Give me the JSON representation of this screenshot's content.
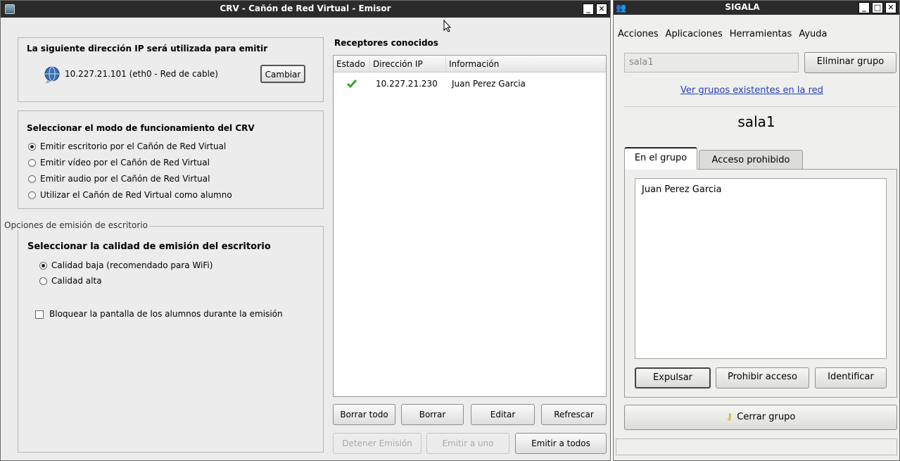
{
  "crv": {
    "title": "CRV - Cañón de Red Virtual - Emisor",
    "ip_section": {
      "heading": "La siguiente dirección IP será utilizada para emitir",
      "ip_text": "10.227.21.101 (eth0 - Red de cable)",
      "change_button": "Cambiar"
    },
    "mode_section": {
      "heading": "Seleccionar el modo de funcionamiento del CRV",
      "options": [
        {
          "label": "Emitir escritorio por el Cañón de Red Virtual",
          "selected": true
        },
        {
          "label": "Emitir vídeo por el Cañón de Red Virtual",
          "selected": false
        },
        {
          "label": "Emitir audio por el Cañón de Red Virtual",
          "selected": false
        },
        {
          "label": "Utilizar el Cañón de Red Virtual como alumno",
          "selected": false
        }
      ]
    },
    "desktop_options": {
      "legend": "Opciones de emisión de escritorio",
      "quality_heading": "Seleccionar la calidad de emisión del escritorio",
      "quality_options": [
        {
          "label": "Calidad baja (recomendado para WiFi)",
          "selected": true
        },
        {
          "label": "Calidad alta",
          "selected": false
        }
      ],
      "lock_label": "Bloquear la pantalla de los alumnos durante la emisión",
      "lock_checked": false
    },
    "receivers": {
      "heading": "Receptores conocidos",
      "columns": [
        "Estado",
        "Dirección IP",
        "Información"
      ],
      "rows": [
        {
          "status_icon": "check-icon",
          "ip": "10.227.21.230",
          "info": "Juan Perez Garcia"
        }
      ]
    },
    "buttons": {
      "clear_all": "Borrar todo",
      "delete": "Borrar",
      "edit": "Editar",
      "refresh": "Refrescar",
      "stop": "Detener Emisión",
      "emit_one": "Emitir a uno",
      "emit_all": "Emitir a todos"
    }
  },
  "sigala": {
    "title": "SIGALA",
    "menu": [
      "Acciones",
      "Aplicaciones",
      "Herramientas",
      "Ayuda"
    ],
    "group_entry": "sala1",
    "delete_group_button": "Eliminar grupo",
    "groups_link": "Ver grupos existentes en la red",
    "group_name": "sala1",
    "tabs": [
      "En el grupo",
      "Acceso prohibido"
    ],
    "members": [
      "Juan Perez Garcia"
    ],
    "buttons": {
      "expel": "Expulsar",
      "forbid": "Prohibir acceso",
      "identify": "Identificar",
      "close_group": "Cerrar grupo"
    }
  },
  "colors": {
    "accent_link": "#1f3fbf",
    "titlebar": "#2b2b2b",
    "check": "#2ea62e"
  }
}
